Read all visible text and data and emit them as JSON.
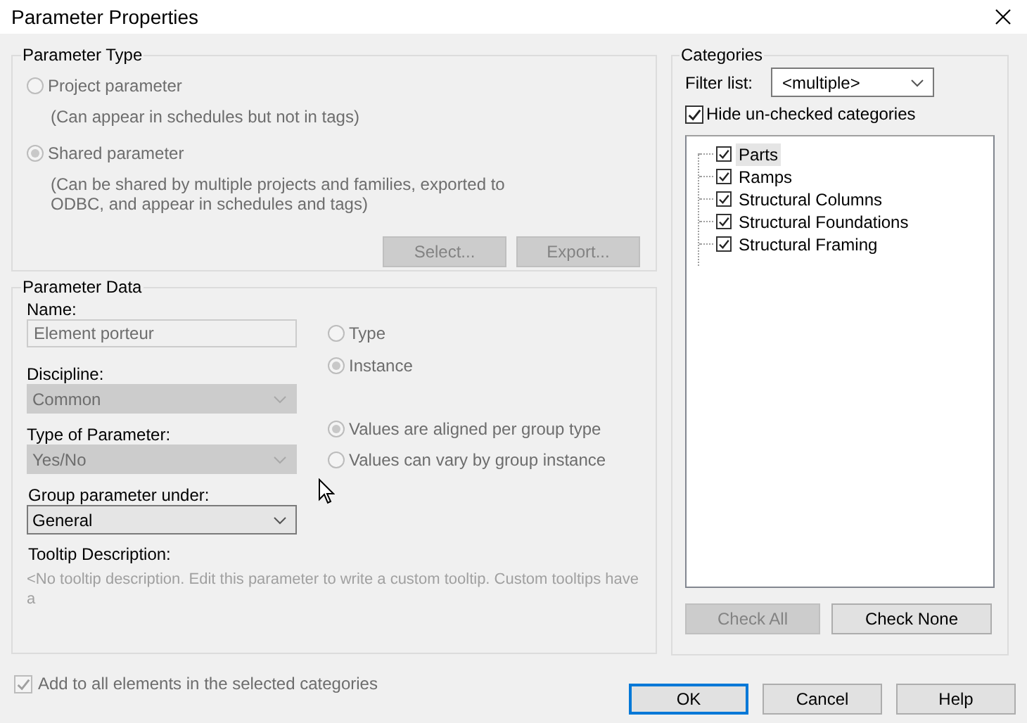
{
  "window": {
    "title": "Parameter Properties"
  },
  "parameter_type": {
    "title": "Parameter Type",
    "options": [
      {
        "label": "Project parameter",
        "description": "(Can appear in schedules but not in tags)",
        "selected": false,
        "disabled": true
      },
      {
        "label": "Shared parameter",
        "description": "(Can be shared by multiple projects and families, exported to ODBC, and appear in schedules and tags)",
        "selected": true,
        "disabled": true
      }
    ],
    "buttons": [
      {
        "label": "Select...",
        "disabled": true
      },
      {
        "label": "Export...",
        "disabled": true
      }
    ]
  },
  "parameter_data": {
    "title": "Parameter Data",
    "fields": [
      {
        "kind": "text",
        "label": "Name:",
        "value": "Element porteur",
        "disabled": true
      },
      {
        "kind": "dropdown",
        "label": "Discipline:",
        "value": "Common",
        "disabled": true
      },
      {
        "kind": "dropdown",
        "label": "Type of Parameter:",
        "value": "Yes/No",
        "disabled": true
      },
      {
        "kind": "dropdown",
        "label": "Group parameter under:",
        "value": "General",
        "disabled": false
      }
    ],
    "instance_options": [
      {
        "label": "Type",
        "selected": false,
        "disabled": true
      },
      {
        "label": "Instance",
        "selected": true,
        "disabled": true
      }
    ],
    "group_options": [
      {
        "label": "Values are aligned per group type",
        "selected": true,
        "disabled": true
      },
      {
        "label": "Values can vary by group instance",
        "selected": false,
        "disabled": true
      }
    ],
    "tooltip": {
      "label": "Tooltip Description:",
      "text": "<No tooltip description. Edit this parameter to write a custom tooltip. Custom tooltips have a"
    }
  },
  "categories": {
    "title": "Categories",
    "filter_label": "Filter list:",
    "filter_value": "<multiple>",
    "hide_unchecked": {
      "label": "Hide un-checked categories",
      "checked": true
    },
    "items": [
      {
        "label": "Parts",
        "checked": true,
        "selected": true
      },
      {
        "label": "Ramps",
        "checked": true,
        "selected": false
      },
      {
        "label": "Structural Columns",
        "checked": true,
        "selected": false
      },
      {
        "label": "Structural Foundations",
        "checked": true,
        "selected": false
      },
      {
        "label": "Structural Framing",
        "checked": true,
        "selected": false
      }
    ],
    "buttons": [
      {
        "label": "Check All",
        "disabled": true
      },
      {
        "label": "Check None",
        "disabled": false
      }
    ]
  },
  "add_to_all": {
    "label": "Add to all elements in the selected categories",
    "checked": true,
    "disabled": true
  },
  "buttons": [
    {
      "label": "OK",
      "default": true
    },
    {
      "label": "Cancel",
      "default": false
    },
    {
      "label": "Help",
      "default": false
    }
  ]
}
